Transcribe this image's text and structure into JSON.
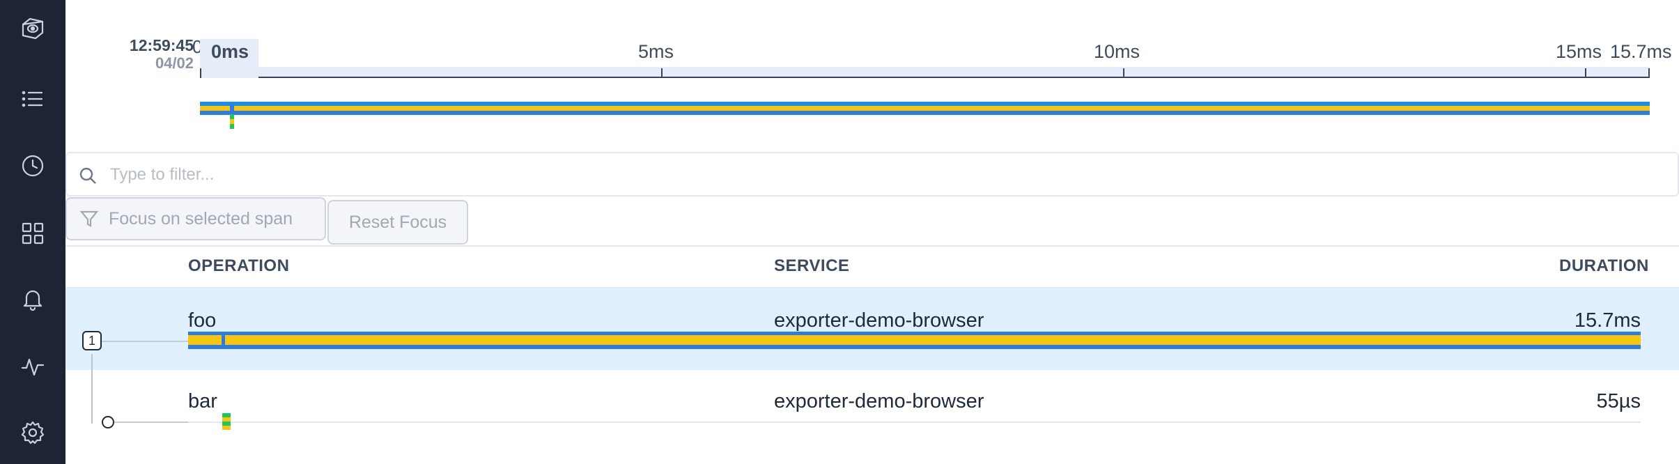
{
  "sidebar": {
    "items": [
      {
        "icon": "logo-icon"
      },
      {
        "icon": "list-icon"
      },
      {
        "icon": "clock-icon"
      },
      {
        "icon": "grid-icon"
      },
      {
        "icon": "bell-icon"
      },
      {
        "icon": "activity-icon"
      },
      {
        "icon": "gear-icon"
      }
    ]
  },
  "timestamp": {
    "time": "12:59:45",
    "date": "04/02"
  },
  "ruler": {
    "clipped_label": "0",
    "ticks": [
      "0ms",
      "5ms",
      "10ms",
      "15ms",
      "15.7ms"
    ]
  },
  "filter": {
    "placeholder": "Type to filter..."
  },
  "buttons": {
    "focus": "Focus on selected span",
    "reset": "Reset Focus"
  },
  "columns": {
    "operation": "OPERATION",
    "service": "SERVICE",
    "duration": "DURATION"
  },
  "spans": [
    {
      "operation": "foo",
      "service": "exporter-demo-browser",
      "duration": "15.7ms",
      "children": "1",
      "selected": true
    },
    {
      "operation": "bar",
      "service": "exporter-demo-browser",
      "duration": "55µs",
      "selected": false
    }
  ],
  "colors": {
    "sidebar_bg": "#1d2433",
    "selected_row": "#e0f0fc",
    "span_blue": "#2d7ce0",
    "span_yellow": "#f9c513",
    "span_green": "#22c55e"
  }
}
